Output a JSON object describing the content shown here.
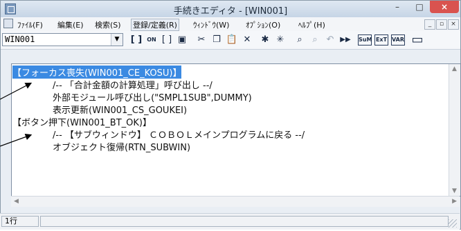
{
  "window": {
    "title": "手続きエディタ - [WIN001]",
    "min_glyph": "–",
    "max_glyph": "□",
    "close_glyph": "×"
  },
  "menubar": {
    "items": [
      {
        "label": "ﾌｧｲﾙ(F)"
      },
      {
        "label": "編集(E)"
      },
      {
        "label": "検索(S)"
      },
      {
        "label": "登録/定義(R)"
      },
      {
        "label": "ｳｨﾝﾄﾞｳ(W)"
      },
      {
        "label": "ｵﾌﾟｼｮﾝ(O)"
      },
      {
        "label": "ﾍﾙﾌﾟ(H)"
      }
    ],
    "mdi": {
      "min": "_",
      "restore": "▫",
      "close": "×"
    }
  },
  "toolbar": {
    "combo_value": "WIN001",
    "buttons": [
      {
        "icon": "bracket-icon",
        "glyph": "[ ]"
      },
      {
        "icon": "on-off-icon",
        "glyph": "ON"
      },
      {
        "icon": "brackets-box-icon",
        "glyph": "[ ]"
      },
      {
        "icon": "properties-icon",
        "glyph": "▣"
      },
      {
        "icon": "cut-icon",
        "glyph": "✂"
      },
      {
        "icon": "copy-icon",
        "glyph": "❐"
      },
      {
        "icon": "paste-icon",
        "glyph": "📋"
      },
      {
        "icon": "delete-icon",
        "glyph": "✕"
      },
      {
        "icon": "asterisk-icon",
        "glyph": "✱"
      },
      {
        "icon": "asterisk-outline-icon",
        "glyph": "✳"
      },
      {
        "icon": "search-icon",
        "glyph": "⌕"
      },
      {
        "icon": "search-next-icon",
        "glyph": "⌕"
      },
      {
        "icon": "undo-icon",
        "glyph": "↶"
      },
      {
        "icon": "run-icon",
        "glyph": "▶▶"
      },
      {
        "icon": "sum-icon",
        "glyph": "SuM"
      },
      {
        "icon": "ext-icon",
        "glyph": "ExT"
      },
      {
        "icon": "var-icon",
        "glyph": "VAR"
      },
      {
        "icon": "window-icon",
        "glyph": "▭"
      }
    ]
  },
  "editor": {
    "lines": [
      {
        "text": "【フォーカス喪失(WIN001_CE_KOSU)】",
        "indent": 0,
        "selected": true
      },
      {
        "text": "/-- 「合計金額の計算処理」呼び出し --/",
        "indent": 1,
        "selected": false
      },
      {
        "text": "外部モジュール呼び出し(\"SMPL1SUB\",DUMMY)",
        "indent": 1,
        "selected": false
      },
      {
        "text": "表示更新(WIN001_CS_GOUKEI)",
        "indent": 1,
        "selected": false
      },
      {
        "text": "【ボタン押下(WIN001_BT_OK)】",
        "indent": 0,
        "selected": false
      },
      {
        "text": "/-- 【サブウィンドウ】 ＣＯＢＯＬメインプログラムに戻る --/",
        "indent": 1,
        "selected": false
      },
      {
        "text": "オブジェクト復帰(RTN_SUBWIN)",
        "indent": 1,
        "selected": false
      }
    ]
  },
  "status": {
    "line": "1行"
  },
  "colors": {
    "selection": "#3b8ae2",
    "close_button": "#d9534f"
  }
}
